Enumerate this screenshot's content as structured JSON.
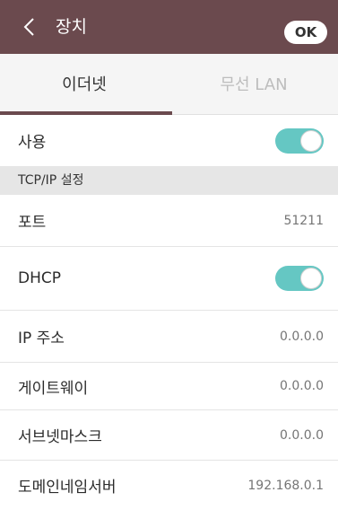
{
  "header": {
    "title": "장치",
    "back_icon": "chevron-left-icon",
    "ok_label": "OK",
    "background_color": "#6b4a4e"
  },
  "tabs": [
    {
      "label": "이더넷",
      "active": true
    },
    {
      "label": "무선 LAN",
      "active": false
    }
  ],
  "use": {
    "label": "사용",
    "toggle_on": true
  },
  "section": {
    "title": "TCP/IP 설정"
  },
  "rows": {
    "port": {
      "label": "포트",
      "value": "51211"
    },
    "dhcp": {
      "label": "DHCP",
      "toggle_on": true
    },
    "ip": {
      "label": "IP 주소",
      "value": "0.0.0.0"
    },
    "gateway": {
      "label": "게이트웨이",
      "value": "0.0.0.0"
    },
    "subnet": {
      "label": "서브넷마스크",
      "value": "0.0.0.0"
    },
    "dns": {
      "label": "도메인네임서버",
      "value": "192.168.0.1"
    }
  },
  "colors": {
    "accent": "#65c7c3",
    "header": "#6b4a4e"
  }
}
